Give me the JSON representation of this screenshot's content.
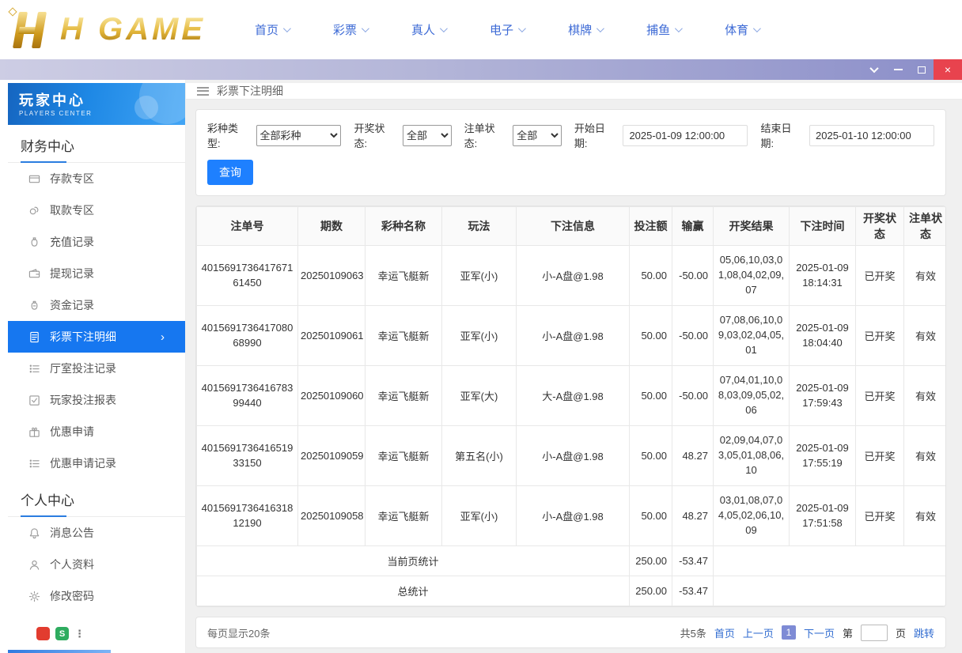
{
  "brand": {
    "logo_text": "H GAME"
  },
  "colors": {
    "accent_blue": "#1677f0",
    "logo_gold": "#d4a017",
    "close_red": "#e8434e"
  },
  "top_nav": {
    "items": [
      {
        "label": "首页"
      },
      {
        "label": "彩票"
      },
      {
        "label": "真人"
      },
      {
        "label": "电子"
      },
      {
        "label": "棋牌"
      },
      {
        "label": "捕鱼"
      },
      {
        "label": "体育"
      }
    ]
  },
  "window": {
    "controls": [
      "collapse-icon",
      "minimize-icon",
      "maximize-icon",
      "close-icon"
    ],
    "close_glyph": "×"
  },
  "sidebar": {
    "header": {
      "title": "玩家中心",
      "subtitle": "PLAYERS CENTER"
    },
    "sections": [
      {
        "title": "财务中心",
        "items": [
          {
            "label": "存款专区",
            "icon": "deposit-card-icon"
          },
          {
            "label": "取款专区",
            "icon": "withdraw-coins-icon"
          },
          {
            "label": "充值记录",
            "icon": "recharge-record-icon"
          },
          {
            "label": "提现记录",
            "icon": "withdrawal-record-icon"
          },
          {
            "label": "资金记录",
            "icon": "funds-record-icon"
          },
          {
            "label": "彩票下注明细",
            "icon": "lottery-bet-detail-icon",
            "active": true,
            "arrow": "›"
          },
          {
            "label": "厅室投注记录",
            "icon": "hall-bet-record-icon"
          },
          {
            "label": "玩家投注报表",
            "icon": "player-bet-report-icon"
          },
          {
            "label": "优惠申请",
            "icon": "promo-apply-icon"
          },
          {
            "label": "优惠申请记录",
            "icon": "promo-apply-record-icon"
          }
        ]
      },
      {
        "title": "个人中心",
        "items": [
          {
            "label": "消息公告",
            "icon": "message-announce-icon"
          },
          {
            "label": "个人资料",
            "icon": "profile-icon"
          },
          {
            "label": "修改密码",
            "icon": "change-password-icon"
          }
        ]
      }
    ]
  },
  "main": {
    "breadcrumb": "彩票下注明细",
    "filters": {
      "lottery_type": {
        "label": "彩种类型:",
        "value": "全部彩种"
      },
      "draw_status": {
        "label": "开奖状态:",
        "value": "全部"
      },
      "bet_status": {
        "label": "注单状态:",
        "value": "全部"
      },
      "start_date": {
        "label": "开始日期:",
        "value": "2025-01-09 12:00:00"
      },
      "end_date": {
        "label": "结束日期:",
        "value": "2025-01-10 12:00:00"
      },
      "search_label": "查询"
    },
    "table": {
      "headers": [
        "注单号",
        "期数",
        "彩种名称",
        "玩法",
        "下注信息",
        "投注额",
        "输赢",
        "开奖结果",
        "下注时间",
        "开奖状态",
        "注单状态"
      ],
      "rows": [
        {
          "bet_no": "401569173641767161450",
          "period": "20250109063",
          "lottery": "幸运飞艇新",
          "play": "亚军(小)",
          "bet_info": "小-A盘@1.98",
          "amount": "50.00",
          "winloss": "-50.00",
          "result": "05,06,10,03,01,08,04,02,09,07",
          "bet_time": "2025-01-09 18:14:31",
          "draw_status": "已开奖",
          "status": "有效"
        },
        {
          "bet_no": "401569173641708068990",
          "period": "20250109061",
          "lottery": "幸运飞艇新",
          "play": "亚军(小)",
          "bet_info": "小-A盘@1.98",
          "amount": "50.00",
          "winloss": "-50.00",
          "result": "07,08,06,10,09,03,02,04,05,01",
          "bet_time": "2025-01-09 18:04:40",
          "draw_status": "已开奖",
          "status": "有效"
        },
        {
          "bet_no": "401569173641678399440",
          "period": "20250109060",
          "lottery": "幸运飞艇新",
          "play": "亚军(大)",
          "bet_info": "大-A盘@1.98",
          "amount": "50.00",
          "winloss": "-50.00",
          "result": "07,04,01,10,08,03,09,05,02,06",
          "bet_time": "2025-01-09 17:59:43",
          "draw_status": "已开奖",
          "status": "有效"
        },
        {
          "bet_no": "401569173641651933150",
          "period": "20250109059",
          "lottery": "幸运飞艇新",
          "play": "第五名(小)",
          "bet_info": "小-A盘@1.98",
          "amount": "50.00",
          "winloss": "48.27",
          "result": "02,09,04,07,03,05,01,08,06,10",
          "bet_time": "2025-01-09 17:55:19",
          "draw_status": "已开奖",
          "status": "有效"
        },
        {
          "bet_no": "401569173641631812190",
          "period": "20250109058",
          "lottery": "幸运飞艇新",
          "play": "亚军(小)",
          "bet_info": "小-A盘@1.98",
          "amount": "50.00",
          "winloss": "48.27",
          "result": "03,01,08,07,04,05,02,06,10,09",
          "bet_time": "2025-01-09 17:51:58",
          "draw_status": "已开奖",
          "status": "有效"
        }
      ],
      "summary": [
        {
          "label": "当前页统计",
          "amount": "250.00",
          "winloss": "-53.47"
        },
        {
          "label": "总统计",
          "amount": "250.00",
          "winloss": "-53.47"
        }
      ]
    },
    "pagination": {
      "page_size_text": "每页显示20条",
      "total_text": "共5条",
      "first": "首页",
      "prev": "上一页",
      "current": "1",
      "next": "下一页",
      "jump_prefix": "第",
      "jump_suffix": "页",
      "jump_action": "跳转"
    }
  }
}
